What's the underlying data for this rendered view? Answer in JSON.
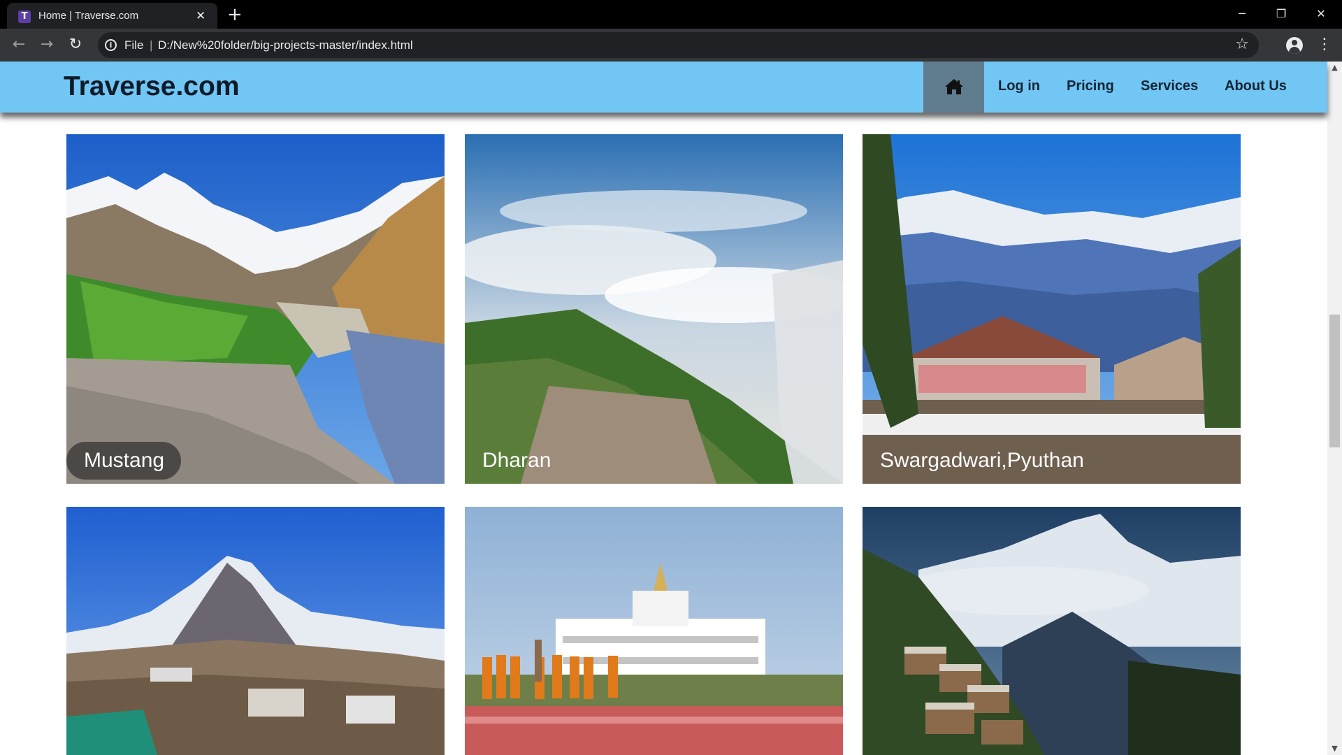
{
  "browser": {
    "tab_title": "Home | Traverse.com",
    "tab_favicon_letter": "T",
    "new_tab_symbol": "+",
    "scheme_label": "File",
    "url": "D:/New%20folder/big-projects-master/index.html",
    "window_controls": [
      "minimize-icon",
      "restore-icon",
      "close-icon"
    ]
  },
  "site": {
    "brand": "Traverse.com",
    "nav": {
      "home_icon": "home-icon",
      "links": [
        "Log in",
        "Pricing",
        "Services",
        "About Us"
      ]
    }
  },
  "destinations": [
    {
      "name": "Mustang"
    },
    {
      "name": "Dharan"
    },
    {
      "name": "Swargadwari,Pyuthan"
    },
    {
      "name": ""
    },
    {
      "name": ""
    },
    {
      "name": ""
    }
  ],
  "colors": {
    "navbar": "#72c6f4",
    "home_button": "#5f7d8f",
    "chrome_dark": "#35363a"
  }
}
